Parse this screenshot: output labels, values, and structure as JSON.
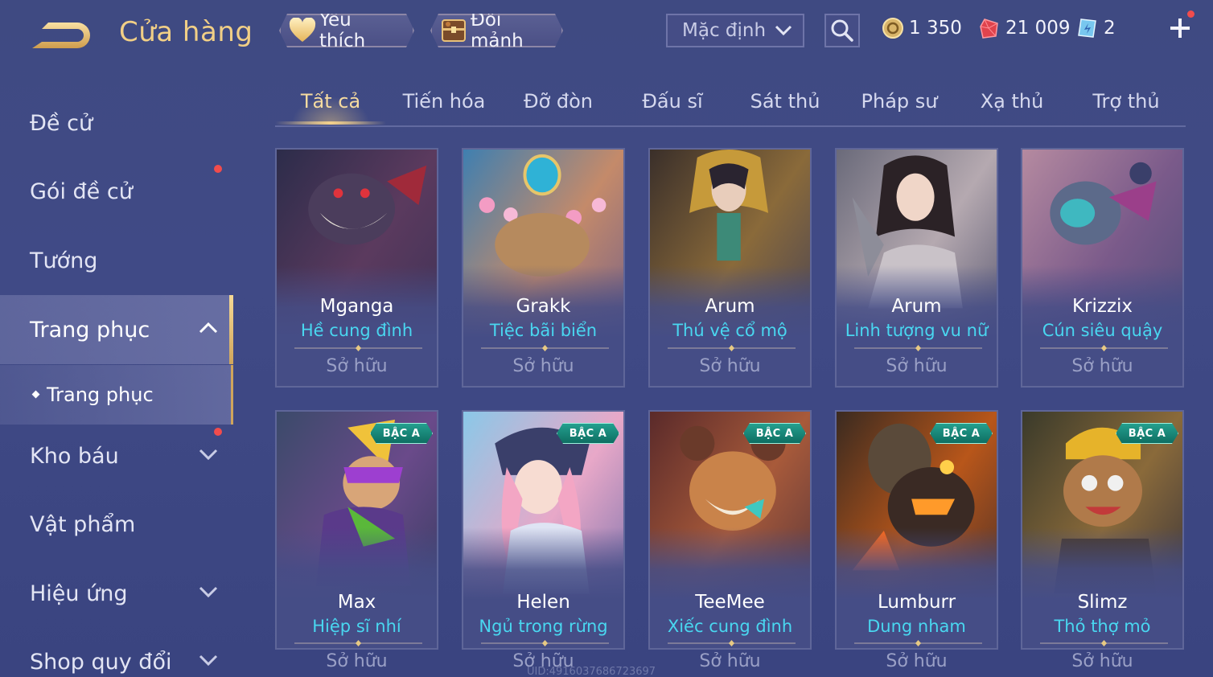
{
  "header": {
    "title": "Cửa hàng",
    "favorites_label": "Yêu thích",
    "exchange_label": "Đổi mảnh",
    "sort_value": "Mặc định",
    "currencies": {
      "gold": "1 350",
      "ruby": "21 009",
      "voucher": "2"
    },
    "add_button_icon": "plus-icon"
  },
  "sidebar": {
    "items": [
      {
        "label": "Đề cử"
      },
      {
        "label": "Gói đề cử"
      },
      {
        "label": "Tướng"
      },
      {
        "label": "Trang phục"
      },
      {
        "label": "Trang phục"
      },
      {
        "label": "Kho báu"
      },
      {
        "label": "Vật phẩm"
      },
      {
        "label": "Hiệu ứng"
      },
      {
        "label": "Shop quy đổi"
      }
    ]
  },
  "tabs": [
    {
      "label": "Tất cả"
    },
    {
      "label": "Tiến hóa"
    },
    {
      "label": "Đỡ đòn"
    },
    {
      "label": "Đấu sĩ"
    },
    {
      "label": "Sát thủ"
    },
    {
      "label": "Pháp sư"
    },
    {
      "label": "Xạ thủ"
    },
    {
      "label": "Trợ thủ"
    }
  ],
  "cards": [
    {
      "hero": "Mganga",
      "skin": "Hề cung đình",
      "status": "Sở hữu",
      "tier": ""
    },
    {
      "hero": "Grakk",
      "skin": "Tiệc bãi biển",
      "status": "Sở hữu",
      "tier": ""
    },
    {
      "hero": "Arum",
      "skin": "Thú vệ cổ mộ",
      "status": "Sở hữu",
      "tier": ""
    },
    {
      "hero": "Arum",
      "skin": "Linh tượng vu nữ",
      "status": "Sở hữu",
      "tier": ""
    },
    {
      "hero": "Krizzix",
      "skin": "Cún siêu quậy",
      "status": "Sở hữu",
      "tier": ""
    },
    {
      "hero": "Max",
      "skin": "Hiệp sĩ nhí",
      "status": "Sở hữu",
      "tier": "BẬC A"
    },
    {
      "hero": "Helen",
      "skin": "Ngủ trong rừng",
      "status": "Sở hữu",
      "tier": "BẬC A"
    },
    {
      "hero": "TeeMee",
      "skin": "Xiếc cung đình",
      "status": "Sở hữu",
      "tier": "BẬC A"
    },
    {
      "hero": "Lumburr",
      "skin": "Dung nham",
      "status": "Sở hữu",
      "tier": "BẬC A"
    },
    {
      "hero": "Slimz",
      "skin": "Thỏ thợ mỏ",
      "status": "Sở hữu",
      "tier": "BẬC A"
    }
  ],
  "watermark": "UID:4916037686723697",
  "colors": {
    "background": "#404a86",
    "title_gold": "#f1cf86",
    "skin_name_cyan": "#49d7f0",
    "owned_grey": "#9aa0c6",
    "notification_red": "#f24c4c",
    "tier_badge_teal": "#1a8a7a"
  }
}
